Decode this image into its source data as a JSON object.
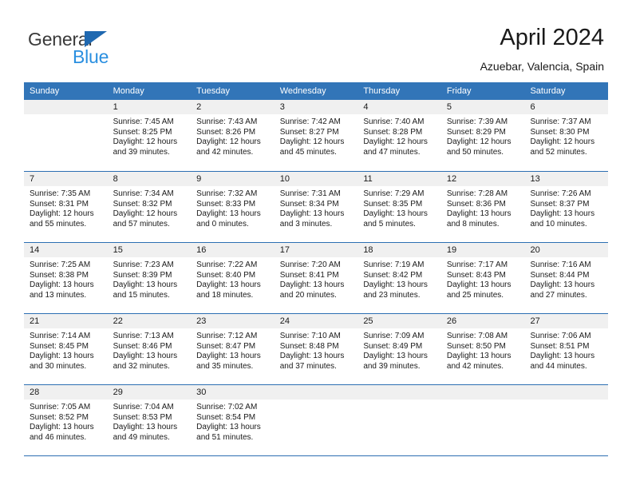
{
  "brand": {
    "word_one": "General",
    "word_two": "Blue",
    "logo_icon": "triangle-flag-icon",
    "accent_blue": "#2a8fe0",
    "dark_blue": "#1f68b0"
  },
  "header": {
    "title": "April 2024",
    "location": "Azuebar, Valencia, Spain"
  },
  "calendar": {
    "header_bg": "#3275b8",
    "daynum_bg": "#f0f0f0",
    "weekdays": [
      "Sunday",
      "Monday",
      "Tuesday",
      "Wednesday",
      "Thursday",
      "Friday",
      "Saturday"
    ],
    "weeks": [
      [
        {
          "day": "",
          "sunrise": "",
          "sunset": "",
          "daylight_line1": "",
          "daylight_line2": ""
        },
        {
          "day": "1",
          "sunrise": "Sunrise: 7:45 AM",
          "sunset": "Sunset: 8:25 PM",
          "daylight_line1": "Daylight: 12 hours",
          "daylight_line2": "and 39 minutes."
        },
        {
          "day": "2",
          "sunrise": "Sunrise: 7:43 AM",
          "sunset": "Sunset: 8:26 PM",
          "daylight_line1": "Daylight: 12 hours",
          "daylight_line2": "and 42 minutes."
        },
        {
          "day": "3",
          "sunrise": "Sunrise: 7:42 AM",
          "sunset": "Sunset: 8:27 PM",
          "daylight_line1": "Daylight: 12 hours",
          "daylight_line2": "and 45 minutes."
        },
        {
          "day": "4",
          "sunrise": "Sunrise: 7:40 AM",
          "sunset": "Sunset: 8:28 PM",
          "daylight_line1": "Daylight: 12 hours",
          "daylight_line2": "and 47 minutes."
        },
        {
          "day": "5",
          "sunrise": "Sunrise: 7:39 AM",
          "sunset": "Sunset: 8:29 PM",
          "daylight_line1": "Daylight: 12 hours",
          "daylight_line2": "and 50 minutes."
        },
        {
          "day": "6",
          "sunrise": "Sunrise: 7:37 AM",
          "sunset": "Sunset: 8:30 PM",
          "daylight_line1": "Daylight: 12 hours",
          "daylight_line2": "and 52 minutes."
        }
      ],
      [
        {
          "day": "7",
          "sunrise": "Sunrise: 7:35 AM",
          "sunset": "Sunset: 8:31 PM",
          "daylight_line1": "Daylight: 12 hours",
          "daylight_line2": "and 55 minutes."
        },
        {
          "day": "8",
          "sunrise": "Sunrise: 7:34 AM",
          "sunset": "Sunset: 8:32 PM",
          "daylight_line1": "Daylight: 12 hours",
          "daylight_line2": "and 57 minutes."
        },
        {
          "day": "9",
          "sunrise": "Sunrise: 7:32 AM",
          "sunset": "Sunset: 8:33 PM",
          "daylight_line1": "Daylight: 13 hours",
          "daylight_line2": "and 0 minutes."
        },
        {
          "day": "10",
          "sunrise": "Sunrise: 7:31 AM",
          "sunset": "Sunset: 8:34 PM",
          "daylight_line1": "Daylight: 13 hours",
          "daylight_line2": "and 3 minutes."
        },
        {
          "day": "11",
          "sunrise": "Sunrise: 7:29 AM",
          "sunset": "Sunset: 8:35 PM",
          "daylight_line1": "Daylight: 13 hours",
          "daylight_line2": "and 5 minutes."
        },
        {
          "day": "12",
          "sunrise": "Sunrise: 7:28 AM",
          "sunset": "Sunset: 8:36 PM",
          "daylight_line1": "Daylight: 13 hours",
          "daylight_line2": "and 8 minutes."
        },
        {
          "day": "13",
          "sunrise": "Sunrise: 7:26 AM",
          "sunset": "Sunset: 8:37 PM",
          "daylight_line1": "Daylight: 13 hours",
          "daylight_line2": "and 10 minutes."
        }
      ],
      [
        {
          "day": "14",
          "sunrise": "Sunrise: 7:25 AM",
          "sunset": "Sunset: 8:38 PM",
          "daylight_line1": "Daylight: 13 hours",
          "daylight_line2": "and 13 minutes."
        },
        {
          "day": "15",
          "sunrise": "Sunrise: 7:23 AM",
          "sunset": "Sunset: 8:39 PM",
          "daylight_line1": "Daylight: 13 hours",
          "daylight_line2": "and 15 minutes."
        },
        {
          "day": "16",
          "sunrise": "Sunrise: 7:22 AM",
          "sunset": "Sunset: 8:40 PM",
          "daylight_line1": "Daylight: 13 hours",
          "daylight_line2": "and 18 minutes."
        },
        {
          "day": "17",
          "sunrise": "Sunrise: 7:20 AM",
          "sunset": "Sunset: 8:41 PM",
          "daylight_line1": "Daylight: 13 hours",
          "daylight_line2": "and 20 minutes."
        },
        {
          "day": "18",
          "sunrise": "Sunrise: 7:19 AM",
          "sunset": "Sunset: 8:42 PM",
          "daylight_line1": "Daylight: 13 hours",
          "daylight_line2": "and 23 minutes."
        },
        {
          "day": "19",
          "sunrise": "Sunrise: 7:17 AM",
          "sunset": "Sunset: 8:43 PM",
          "daylight_line1": "Daylight: 13 hours",
          "daylight_line2": "and 25 minutes."
        },
        {
          "day": "20",
          "sunrise": "Sunrise: 7:16 AM",
          "sunset": "Sunset: 8:44 PM",
          "daylight_line1": "Daylight: 13 hours",
          "daylight_line2": "and 27 minutes."
        }
      ],
      [
        {
          "day": "21",
          "sunrise": "Sunrise: 7:14 AM",
          "sunset": "Sunset: 8:45 PM",
          "daylight_line1": "Daylight: 13 hours",
          "daylight_line2": "and 30 minutes."
        },
        {
          "day": "22",
          "sunrise": "Sunrise: 7:13 AM",
          "sunset": "Sunset: 8:46 PM",
          "daylight_line1": "Daylight: 13 hours",
          "daylight_line2": "and 32 minutes."
        },
        {
          "day": "23",
          "sunrise": "Sunrise: 7:12 AM",
          "sunset": "Sunset: 8:47 PM",
          "daylight_line1": "Daylight: 13 hours",
          "daylight_line2": "and 35 minutes."
        },
        {
          "day": "24",
          "sunrise": "Sunrise: 7:10 AM",
          "sunset": "Sunset: 8:48 PM",
          "daylight_line1": "Daylight: 13 hours",
          "daylight_line2": "and 37 minutes."
        },
        {
          "day": "25",
          "sunrise": "Sunrise: 7:09 AM",
          "sunset": "Sunset: 8:49 PM",
          "daylight_line1": "Daylight: 13 hours",
          "daylight_line2": "and 39 minutes."
        },
        {
          "day": "26",
          "sunrise": "Sunrise: 7:08 AM",
          "sunset": "Sunset: 8:50 PM",
          "daylight_line1": "Daylight: 13 hours",
          "daylight_line2": "and 42 minutes."
        },
        {
          "day": "27",
          "sunrise": "Sunrise: 7:06 AM",
          "sunset": "Sunset: 8:51 PM",
          "daylight_line1": "Daylight: 13 hours",
          "daylight_line2": "and 44 minutes."
        }
      ],
      [
        {
          "day": "28",
          "sunrise": "Sunrise: 7:05 AM",
          "sunset": "Sunset: 8:52 PM",
          "daylight_line1": "Daylight: 13 hours",
          "daylight_line2": "and 46 minutes."
        },
        {
          "day": "29",
          "sunrise": "Sunrise: 7:04 AM",
          "sunset": "Sunset: 8:53 PM",
          "daylight_line1": "Daylight: 13 hours",
          "daylight_line2": "and 49 minutes."
        },
        {
          "day": "30",
          "sunrise": "Sunrise: 7:02 AM",
          "sunset": "Sunset: 8:54 PM",
          "daylight_line1": "Daylight: 13 hours",
          "daylight_line2": "and 51 minutes."
        },
        {
          "day": "",
          "sunrise": "",
          "sunset": "",
          "daylight_line1": "",
          "daylight_line2": ""
        },
        {
          "day": "",
          "sunrise": "",
          "sunset": "",
          "daylight_line1": "",
          "daylight_line2": ""
        },
        {
          "day": "",
          "sunrise": "",
          "sunset": "",
          "daylight_line1": "",
          "daylight_line2": ""
        },
        {
          "day": "",
          "sunrise": "",
          "sunset": "",
          "daylight_line1": "",
          "daylight_line2": ""
        }
      ]
    ]
  }
}
